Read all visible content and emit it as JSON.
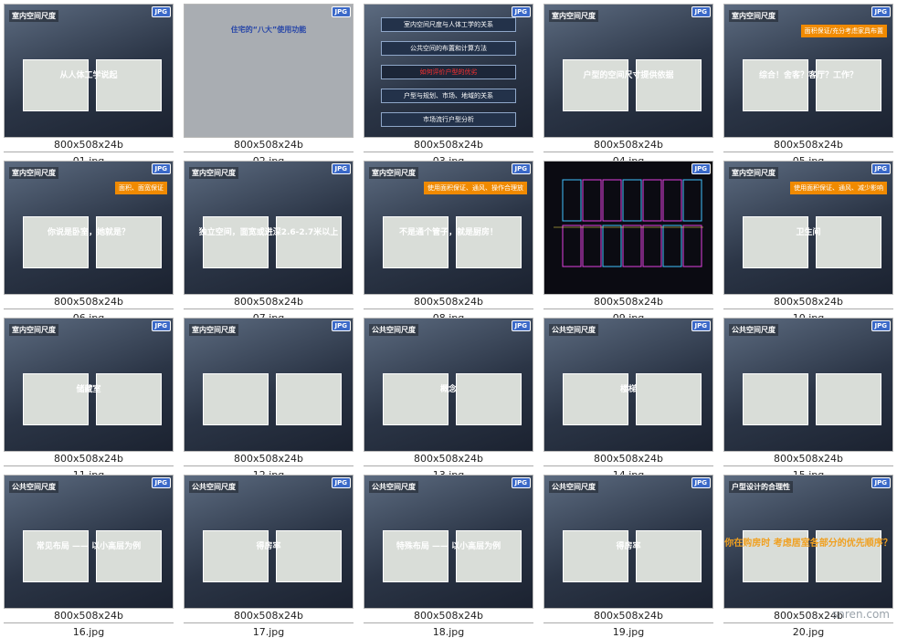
{
  "thumbnails": [
    {
      "title": "室内空间尺度",
      "caption": "从人体工学说起",
      "dims": "800x508x24b",
      "file": "01.jpg",
      "badge": "JPG",
      "style": "blue"
    },
    {
      "title": "",
      "caption": "住宅的“八大”使用功能",
      "dims": "800x508x24b",
      "file": "02.jpg",
      "badge": "JPG",
      "style": "gray"
    },
    {
      "title": "",
      "caption": "",
      "dims": "800x508x24b",
      "file": "03.jpg",
      "badge": "JPG",
      "style": "menu",
      "menu": [
        "室内空间尺度与人体工学的关系",
        "公共空间的布置和计算方法",
        "如何评价户型的优劣",
        "户型与规划、市场、地域的关系",
        "市场流行户型分析"
      ]
    },
    {
      "title": "室内空间尺度",
      "caption": "户型的空间尺寸提供依据",
      "dims": "800x508x24b",
      "file": "04.jpg",
      "badge": "JPG",
      "style": "blue"
    },
    {
      "title": "室内空间尺度",
      "caption": "综合！舍客？客厅？工作？",
      "dims": "800x508x24b",
      "file": "05.jpg",
      "badge": "JPG",
      "style": "blue",
      "orange": "面积保证/充分考虑家具布置"
    },
    {
      "title": "室内空间尺度",
      "caption": "你说是卧室，她就是？",
      "dims": "800x508x24b",
      "file": "06.jpg",
      "badge": "JPG",
      "style": "blue",
      "orange": "面积、面宽保证"
    },
    {
      "title": "室内空间尺度",
      "caption": "独立空间，面宽或进深2.6-2.7米以上",
      "dims": "800x508x24b",
      "file": "07.jpg",
      "badge": "JPG",
      "style": "blue"
    },
    {
      "title": "室内空间尺度",
      "caption": "不是通个管子，就是厨房！",
      "dims": "800x508x24b",
      "file": "08.jpg",
      "badge": "JPG",
      "style": "blue",
      "orange": "使用面积保证、通风、操作合理放"
    },
    {
      "title": "",
      "caption": "",
      "dims": "800x508x24b",
      "file": "09.jpg",
      "badge": "JPG",
      "style": "plan"
    },
    {
      "title": "室内空间尺度",
      "caption": "卫生间",
      "dims": "800x508x24b",
      "file": "10.jpg",
      "badge": "JPG",
      "style": "blue",
      "orange": "使用面积保证、通风、减少影响"
    },
    {
      "title": "室内空间尺度",
      "caption": "储藏室",
      "dims": "800x508x24b",
      "file": "11.jpg",
      "badge": "JPG",
      "style": "blue"
    },
    {
      "title": "室内空间尺度",
      "caption": "",
      "dims": "800x508x24b",
      "file": "12.jpg",
      "badge": "JPG",
      "style": "blue"
    },
    {
      "title": "公共空间尺度",
      "caption": "概念",
      "dims": "800x508x24b",
      "file": "13.jpg",
      "badge": "JPG",
      "style": "blue"
    },
    {
      "title": "公共空间尺度",
      "caption": "楼梯",
      "dims": "800x508x24b",
      "file": "14.jpg",
      "badge": "JPG",
      "style": "blue"
    },
    {
      "title": "公共空间尺度",
      "caption": "",
      "dims": "800x508x24b",
      "file": "15.jpg",
      "badge": "JPG",
      "style": "blue"
    },
    {
      "title": "公共空间尺度",
      "caption": "常见布局 —— 以小高层为例",
      "dims": "800x508x24b",
      "file": "16.jpg",
      "badge": "JPG",
      "style": "blue"
    },
    {
      "title": "公共空间尺度",
      "caption": "得房率",
      "dims": "800x508x24b",
      "file": "17.jpg",
      "badge": "JPG",
      "style": "blue"
    },
    {
      "title": "公共空间尺度",
      "caption": "特殊布局 —— 以小高层为例",
      "dims": "800x508x24b",
      "file": "18.jpg",
      "badge": "JPG",
      "style": "blue"
    },
    {
      "title": "公共空间尺度",
      "caption": "得房率",
      "dims": "800x508x24b",
      "file": "19.jpg",
      "badge": "JPG",
      "style": "blue"
    },
    {
      "title": "户型设计的合理性",
      "caption": "你在购房时 考虑居室各部分的优先顺序？",
      "dims": "800x508x24b",
      "file": "20.jpg",
      "badge": "JPG",
      "style": "blue"
    }
  ],
  "watermark": "snren.com"
}
